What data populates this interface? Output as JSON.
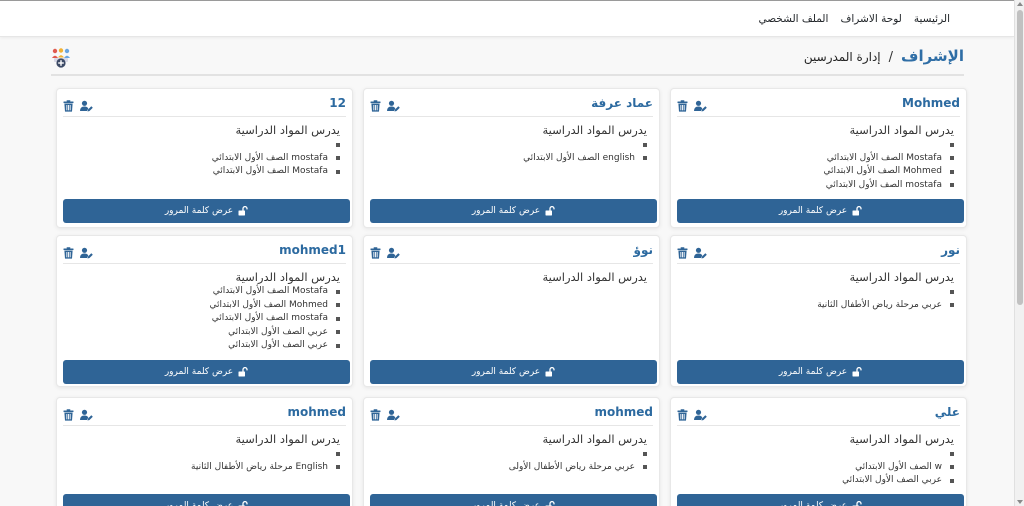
{
  "nav": {
    "home": "الرئيسية",
    "dashboard": "لوحة الاشراف",
    "profile": "الملف الشخصي"
  },
  "breadcrumb": {
    "root": "الإشراف",
    "separator": "/",
    "current": "إدارة المدرسين"
  },
  "icons": {
    "add_teacher": "add-teacher-icon",
    "edit": "user-edit-icon",
    "delete": "trash-icon",
    "unlock": "unlock-icon"
  },
  "colors": {
    "accent": "#2f6496",
    "name": "#2c6aa0",
    "button_text": "#ffffff"
  },
  "subjects_title": "يدرس المواد الدراسية",
  "button_label": "عرض كلمة المرور",
  "teachers": [
    {
      "name": "Mohmed",
      "subjects": [
        "",
        "Mostafa الصف الأول الابتدائي",
        "Mohmed الصف الأول الابتدائي",
        "mostafa الصف الأول الابتدائي"
      ]
    },
    {
      "name": "عماد عرفة",
      "subjects": [
        "",
        "english الصف الأول الابتدائي"
      ]
    },
    {
      "name": "12",
      "subjects": [
        "",
        "mostafa الصف الأول الابتدائي",
        "Mostafa الصف الأول الابتدائي"
      ]
    },
    {
      "name": "نور",
      "subjects": [
        "",
        "عربي مرحلة رياض الأطفال الثانية"
      ]
    },
    {
      "name": "نوؤ",
      "subjects": []
    },
    {
      "name": "mohmed1",
      "subjects": [
        "Mostafa الصف الأول الابتدائي",
        "Mohmed الصف الأول الابتدائي",
        "mostafa الصف الأول الابتدائي",
        "عربي الصف الأول الابتدائي",
        "عربي الصف الأول الابتدائي"
      ]
    },
    {
      "name": "علي",
      "subjects": [
        "",
        "w الصف الأول الابتدائي",
        "عربي الصف الأول الابتدائي"
      ]
    },
    {
      "name": "mohmed",
      "subjects": [
        "",
        "عربي مرحلة رياض الأطفال الأولى"
      ]
    },
    {
      "name": "mohmed",
      "subjects": [
        "",
        "English مرحلة رياض الأطفال الثانية"
      ]
    }
  ]
}
